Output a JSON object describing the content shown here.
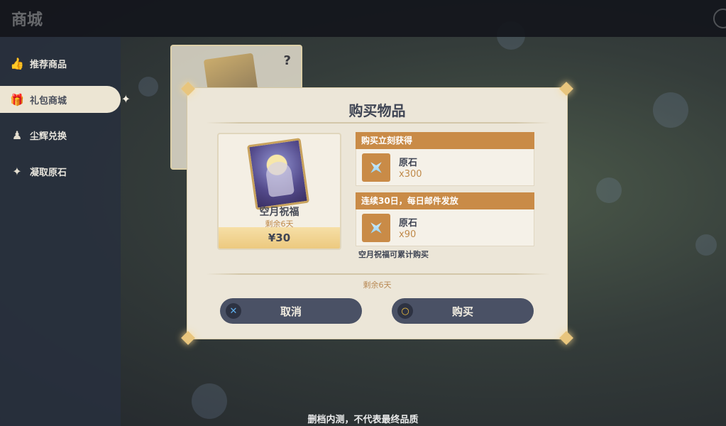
{
  "topbar": {
    "title": "商城"
  },
  "sidebar": {
    "items": [
      {
        "label": "推荐商品",
        "icon": "thumbs-up-icon"
      },
      {
        "label": "礼包商城",
        "icon": "gift-icon",
        "active": true
      },
      {
        "label": "尘辉兑换",
        "icon": "stardust-icon"
      },
      {
        "label": "凝取原石",
        "icon": "sparkle-icon"
      }
    ]
  },
  "background_card": {
    "help": "?"
  },
  "dialog": {
    "title": "购买物品",
    "item": {
      "name": "空月祝福",
      "remaining": "剩余6天",
      "price": "¥30"
    },
    "sections": [
      {
        "header": "购买立刻获得",
        "reward": {
          "name": "原石",
          "qty": "x300"
        }
      },
      {
        "header": "连续30日，每日邮件发放",
        "reward": {
          "name": "原石",
          "qty": "x90"
        }
      }
    ],
    "note": "空月祝福可累计购买",
    "remaining": "剩余6天",
    "cancel": {
      "label": "取消",
      "icon": "x-button-icon",
      "glyph": "✕"
    },
    "confirm": {
      "label": "购买",
      "icon": "circle-button-icon",
      "glyph": "○"
    }
  },
  "footer": {
    "text": "删档内测，不代表最终品质"
  },
  "colors": {
    "accent": "#c98b47",
    "panel": "#ece6d8",
    "button": "#4a5165",
    "price_bar": "#ecc97f"
  }
}
